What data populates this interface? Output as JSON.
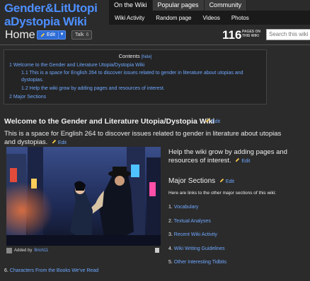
{
  "wiki": {
    "title_line1": "Gender&LitUtopi",
    "title_line2": "aDystopia Wiki"
  },
  "nav": {
    "tabs": [
      "On the Wiki",
      "Popular pages",
      "Community"
    ],
    "subtabs": [
      "Wiki Activity",
      "Random page",
      "Videos",
      "Photos"
    ]
  },
  "page": {
    "title": "Home",
    "edit_label": "Edit",
    "talk_label": "Talk",
    "talk_count": "6",
    "page_count": "116",
    "page_count_label": "PAGES ON THIS WIKI",
    "search_placeholder": "Search this wiki"
  },
  "toc": {
    "title": "Contents",
    "hide": "[hide]",
    "item1": "1 Welcome to the Gender and Literature Utopia/Dystopia Wiki",
    "item1a": "1.1 This is a space for English 264 to discover issues related to gender in literature about utopias and dystopias.",
    "item1b": "1.2 Help the wiki grow by adding pages and resources of interest.",
    "item2": "2 Major Sections"
  },
  "section1": {
    "heading": "Welcome to the Gender and Literature Utopia/Dystopia Wiki",
    "edit": "Edit",
    "paragraph": "This is a space for English 264 to discover issues related to gender in literature about utopias and dystopias.",
    "para_edit": "Edit"
  },
  "image": {
    "caption_prefix": "Added by",
    "caption_user": "Brich11"
  },
  "right": {
    "help": "Help the wiki grow by adding pages and resources of interest.",
    "help_edit": "Edit",
    "major_heading": "Major Sections",
    "major_edit": "Edit",
    "major_intro": "Here are links to the other major sections of this wiki:",
    "items": [
      {
        "num": "1.",
        "label": "Vocabulary"
      },
      {
        "num": "2.",
        "label": "Textual Analyses"
      },
      {
        "num": "3.",
        "label": "Recent Wiki Activity"
      },
      {
        "num": "4.",
        "label": "Wiki Writing Guidelines"
      },
      {
        "num": "5.",
        "label": "Other Interesting Tidbits"
      }
    ]
  },
  "bottom": {
    "num": "6.",
    "label": "Characters From the Books We've Read"
  },
  "colors": {
    "background": "#2b2b2b",
    "link": "#6fa8ff",
    "brand": "#4d8fff",
    "edit_button": "#2d6cd6"
  }
}
